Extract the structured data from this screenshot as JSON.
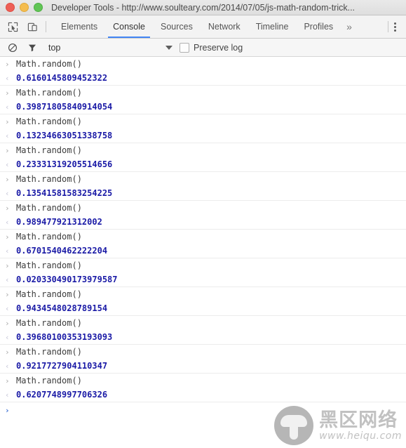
{
  "window": {
    "title": "Developer Tools - http://www.soulteary.com/2014/07/05/js-math-random-trick...",
    "controls": {
      "close": "close-button",
      "minimize": "minimize-button",
      "maximize": "maximize-button"
    }
  },
  "toolbar": {
    "inspect_icon": "inspect-element-icon",
    "device_icon": "toggle-device-toolbar-icon",
    "overflow_label": "»",
    "menu_icon": "more-options-icon",
    "tabs": [
      {
        "label": "Elements",
        "active": false
      },
      {
        "label": "Console",
        "active": true
      },
      {
        "label": "Sources",
        "active": false
      },
      {
        "label": "Network",
        "active": false
      },
      {
        "label": "Timeline",
        "active": false
      },
      {
        "label": "Profiles",
        "active": false
      }
    ]
  },
  "filterbar": {
    "clear_icon": "clear-console-icon",
    "filter_icon": "filter-funnel-icon",
    "context": "top",
    "dropdown_icon": "chevron-down-icon",
    "preserve_log_label": "Preserve log",
    "preserve_log_checked": false
  },
  "console": {
    "input_marker": "›",
    "output_marker": "‹",
    "prompt_marker": "›",
    "entries": [
      {
        "input": "Math.random()",
        "output": "0.6160145809452322"
      },
      {
        "input": "Math.random()",
        "output": "0.39871805840914054"
      },
      {
        "input": "Math.random()",
        "output": "0.13234663051338758"
      },
      {
        "input": "Math.random()",
        "output": "0.23331319205514656"
      },
      {
        "input": "Math.random()",
        "output": "0.13541581583254225"
      },
      {
        "input": "Math.random()",
        "output": "0.989477921312002"
      },
      {
        "input": "Math.random()",
        "output": "0.6701540462222204"
      },
      {
        "input": "Math.random()",
        "output": "0.020330490173979587"
      },
      {
        "input": "Math.random()",
        "output": "0.9434548028789154"
      },
      {
        "input": "Math.random()",
        "output": "0.39680100353193093"
      },
      {
        "input": "Math.random()",
        "output": "0.9217727904110347"
      },
      {
        "input": "Math.random()",
        "output": "0.6207748997706326"
      }
    ]
  },
  "watermark": {
    "logo_icon": "mushroom-logo-icon",
    "brand_cn": "黑区网络",
    "url": "www.heiqu.com"
  }
}
